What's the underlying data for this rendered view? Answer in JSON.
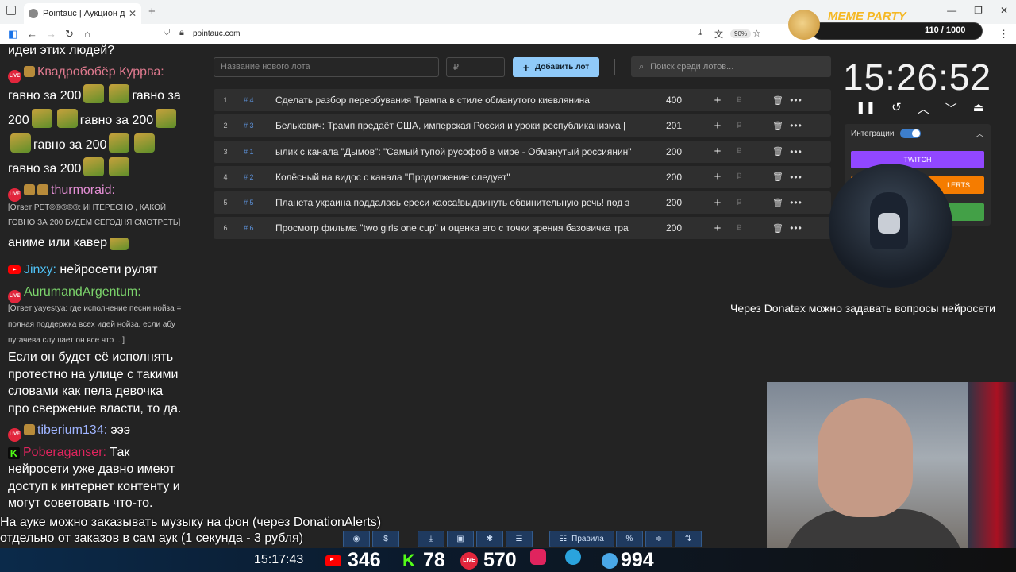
{
  "browser": {
    "tab_title": "Pointauc | Аукцион для стримє",
    "tab_close": "✕",
    "new_tab": "+",
    "url": "pointauc.com",
    "zoom": "90%",
    "win_controls": [
      "—",
      "❐",
      "✕"
    ]
  },
  "app": {
    "new_lot_placeholder": "Название нового лота",
    "amount_placeholder": "₽",
    "add_button": "Добавить лот",
    "search_placeholder": "Поиск среди лотов..."
  },
  "lots": [
    {
      "index": "1",
      "id": "# 4",
      "name": "Сделать разбор переобувания Трампа в стиле обманутого киевлянина",
      "amount": "400"
    },
    {
      "index": "2",
      "id": "# 3",
      "name": "Белькович: Трамп предаёт США, имперская Россия и уроки республиканизма |",
      "amount": "201"
    },
    {
      "index": "3",
      "id": "# 1",
      "name": "ылик с канала \"Дымов\": \"Самый тупой русофоб в мире - Обманутый россиянин\"",
      "amount": "200"
    },
    {
      "index": "4",
      "id": "# 2",
      "name": "Колёсный на видос с канала \"Продолжение следует\"",
      "amount": "200"
    },
    {
      "index": "5",
      "id": "# 5",
      "name": "Планета украина поддалась ереси хаоса!выдвинуть обвинительную речь! под з",
      "amount": "200"
    },
    {
      "index": "6",
      "id": "# 6",
      "name": "Просмотр фильма \"two girls one cup\" и оценка его с точки зрения базовичка тра",
      "amount": "200"
    }
  ],
  "timer": {
    "value": "15:26:52"
  },
  "integrations": {
    "label": "Интеграции",
    "twitch": "TWITCH",
    "donationalerts": "LERTS"
  },
  "meme_party": {
    "title": "MEME PARTY",
    "count": "110 / 1000"
  },
  "donatex_text": "Через Donatex можно задавать вопросы нейросети",
  "chat": {
    "line0": "идеи этих людей?",
    "user1": "Квадробобёр Куррва:",
    "msg1_a": "гавно за 200",
    "msg1_b": "гавно за",
    "msg1_c": "200",
    "msg1_d": "гавно за 200",
    "msg1_e": "гавно за 200",
    "msg1_f": "гавно за 200",
    "user2": "thurmoraid:",
    "reply2_a": "[Ответ PET®®®®®: ИНТЕРЕСНО , КАКОЙ",
    "reply2_b": "ГОВНО ЗА 200 БУДЕМ СЕГОДНЯ СМОТРЕТЬ]",
    "msg2": "аниме или кавер",
    "user3": "Jinxy:",
    "msg3": "нейросети рулят",
    "user4": "AurumandArgentum:",
    "reply4_a": "[Ответ yayestya: где исполнение песни нойза =",
    "reply4_b": "полная поддержка всех идей нойза. если абу",
    "reply4_c": "пугачева слушает он все что ...]",
    "msg4_a": "Если он будет её исполнять",
    "msg4_b": "протестно на улице с такими",
    "msg4_c": "словами как пела девочка",
    "msg4_d": "про свержение власти, то да.",
    "user5": "tiberium134:",
    "msg5": "эээ",
    "user6": "Poberaganser:",
    "msg6_a": "Так",
    "msg6_b": "нейросети уже давно имеют",
    "msg6_c": "доступ к интернет контенту и",
    "msg6_d": "могут советовать что-то."
  },
  "bottom": {
    "line1": "На ауке можно заказывать музыку на фон (через DonationAlerts)",
    "line2": "отдельно от заказов в сам аук (1 секунда - 3 рубля)",
    "rules": "Правила",
    "percent": "%",
    "clock": "15:17:43",
    "youtube_count": "346",
    "kick_count": "78",
    "vk_count": "570",
    "telegram_count": "994"
  },
  "colors": {
    "accent_blue": "#90caf9",
    "twitch": "#9147ff",
    "donationalerts": "#f57c00",
    "green": "#43a047"
  }
}
